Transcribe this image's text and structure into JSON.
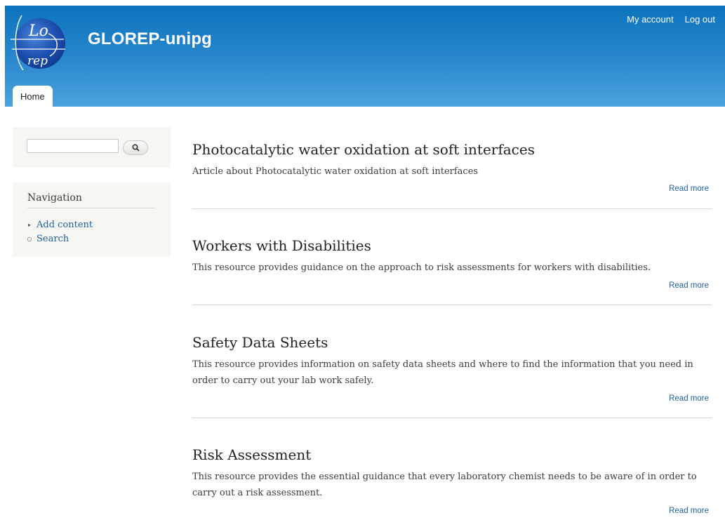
{
  "site": {
    "name": "GLOREP-unipg",
    "logo_text": [
      "Lo",
      "rep"
    ]
  },
  "secondary_menu": [
    {
      "label": "My account"
    },
    {
      "label": "Log out"
    }
  ],
  "main_menu": [
    {
      "label": "Home",
      "active": true
    }
  ],
  "search": {
    "value": "",
    "button_icon": "search-icon"
  },
  "navigation": {
    "title": "Navigation",
    "items": [
      {
        "label": "Add content",
        "marker": "collapsed-arrow"
      },
      {
        "label": "Search",
        "marker": "leaf-circle"
      }
    ]
  },
  "articles": [
    {
      "title": "Photocatalytic water oxidation at soft interfaces",
      "teaser": "Article about Photocatalytic water oxidation at soft interfaces",
      "read_more": "Read more"
    },
    {
      "title": "Workers with Disabilities",
      "teaser": "This resource provides guidance on the approach to risk assessments for workers with disabilities.",
      "read_more": "Read more"
    },
    {
      "title": "Safety Data Sheets",
      "teaser_lines": [
        "This resource provides information on safety data sheets and where to find the information that you need in",
        "order to carry out your lab work safely."
      ],
      "read_more": "Read more"
    },
    {
      "title": "Risk Assessment",
      "teaser_lines": [
        "This resource provides the essential guidance that every laboratory chemist needs to be aware of in order to",
        "carry out a risk assessment."
      ],
      "read_more": "Read more"
    }
  ],
  "colors": {
    "header_top": "#0d73be",
    "header_bottom": "#4aa3dd",
    "link": "#1e5f9d",
    "sidebar_bg": "#f6f6f2"
  }
}
